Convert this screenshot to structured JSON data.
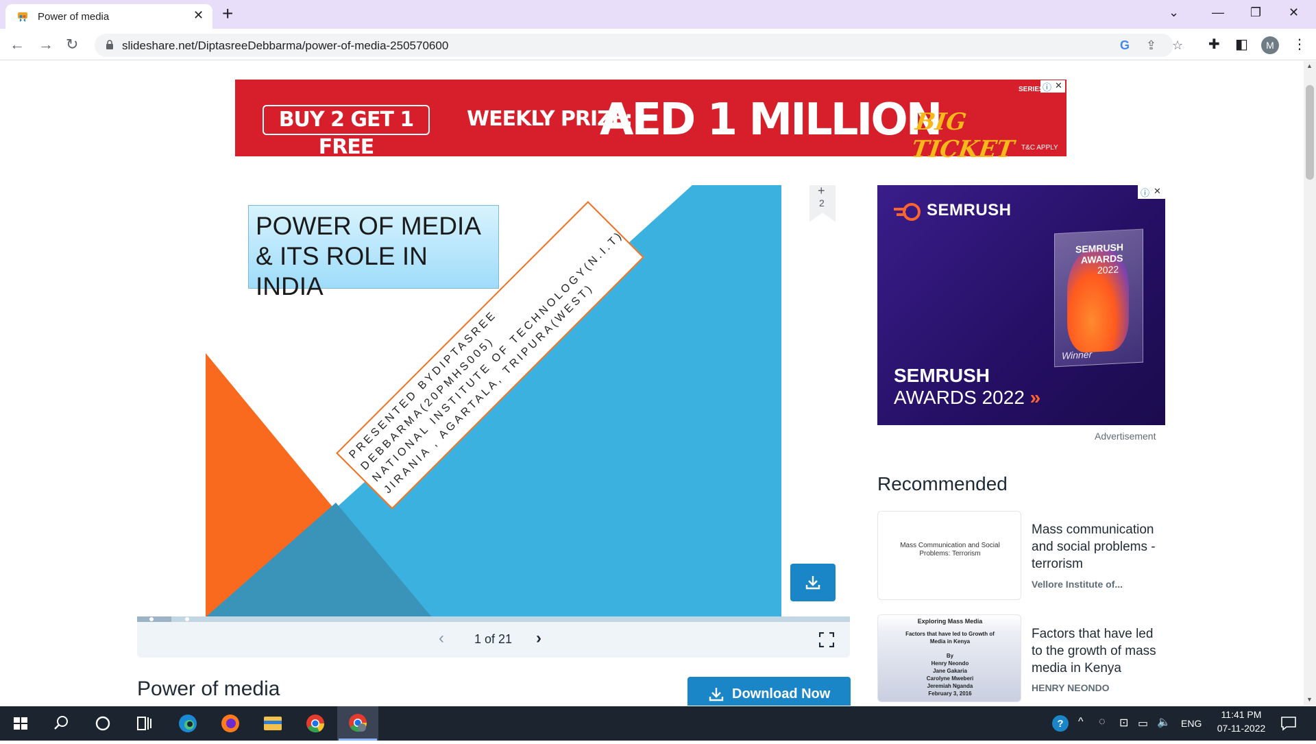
{
  "browser": {
    "tab_title": "Power of media",
    "url": "slideshare.net/DiptasreeDebbarma/power-of-media-250570600",
    "avatar_letter": "M"
  },
  "banner_ad": {
    "buy_label": "BUY 2 GET 1 FREE",
    "weekly_label": "WEEKLY PRIZE:",
    "prize_label": "AED 1 MILLION",
    "logo_text": "BIG TICKET",
    "tc_label": "T&C APPLY",
    "series_label": "SERIES"
  },
  "slide": {
    "title": "POWER OF MEDIA & ITS ROLE IN INDIA",
    "presenter_lines": [
      "PRESENTED BYDIPTASREE",
      "DEBBARMA(20PMHS005)",
      "NATIONAL INSTITUTE OF TECHNOLOGY(N.I.T)",
      "JIRANIA , AGARTALA, TRIPURA(WEST)"
    ],
    "bookmark_plus": "+",
    "bookmark_count": "2",
    "colors": {
      "blue": "#3bb1e0",
      "orange": "#fa6a1e",
      "teal": "#3a93b8"
    }
  },
  "controls": {
    "page_indicator": "1 of 21",
    "progress_fraction": 0.0476
  },
  "document": {
    "title": "Power of media",
    "download_label": "Download Now"
  },
  "sidebar_ad": {
    "brand": "SEMRUSH",
    "award_line1": "SEMRUSH",
    "award_line2": "AWARDS 2022",
    "card_line1": "SEMRUSH",
    "card_line2": "AWARDS",
    "card_line3": "2022",
    "card_winner": "Winner",
    "ad_label": "Advertisement"
  },
  "recommended": {
    "heading": "Recommended",
    "items": [
      {
        "title": "Mass communication and social problems - terrorism",
        "author": "Vellore Institute of...",
        "thumb_text": "Mass Communication and Social Problems: Terrorism"
      },
      {
        "title": "Factors that have led to the growth of mass media in Kenya",
        "author": "HENRY NEONDO",
        "thumb_heading": "Exploring Mass Media",
        "thumb_subtitle": "Factors that have led to Growth of Media in Kenya",
        "thumb_by": "By",
        "thumb_names": [
          "Henry Neondo",
          "Jane Gakaria",
          "Carolyne Mweberi",
          "Jeremiah Nganda"
        ],
        "thumb_date": "February 3, 2016"
      }
    ]
  },
  "taskbar": {
    "language": "ENG",
    "time": "11:41 PM",
    "date": "07-11-2022"
  }
}
